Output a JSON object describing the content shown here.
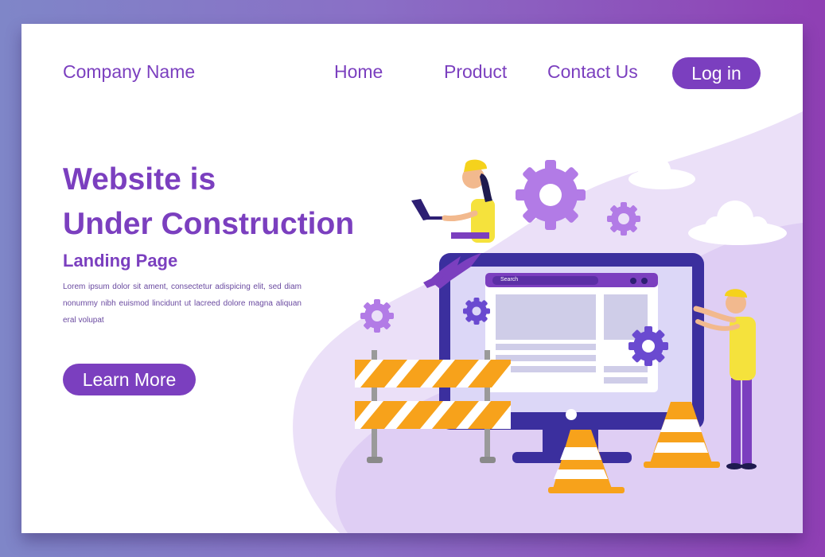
{
  "nav": {
    "brand": "Company Name",
    "links": [
      "Home",
      "Product",
      "Contact Us"
    ],
    "login": "Log in"
  },
  "hero": {
    "title_line1": "Website is",
    "title_line2": "Under Construction",
    "subtitle": "Landing Page",
    "body": "Lorem ipsum dolor sit ament, consectetur adispicing elit, sed diam nonummy nibh euismod lincidunt ut lacreed dolore magna aliquan eral volupat",
    "cta": "Learn More"
  },
  "illustration": {
    "search_placeholder": "Search"
  },
  "colors": {
    "brand": "#7b3fbf",
    "accent_orange": "#f7a21b",
    "worker_yellow": "#f5e23c",
    "monitor_dark": "#3b2f9e",
    "blob_light": "#e8dcf7"
  }
}
